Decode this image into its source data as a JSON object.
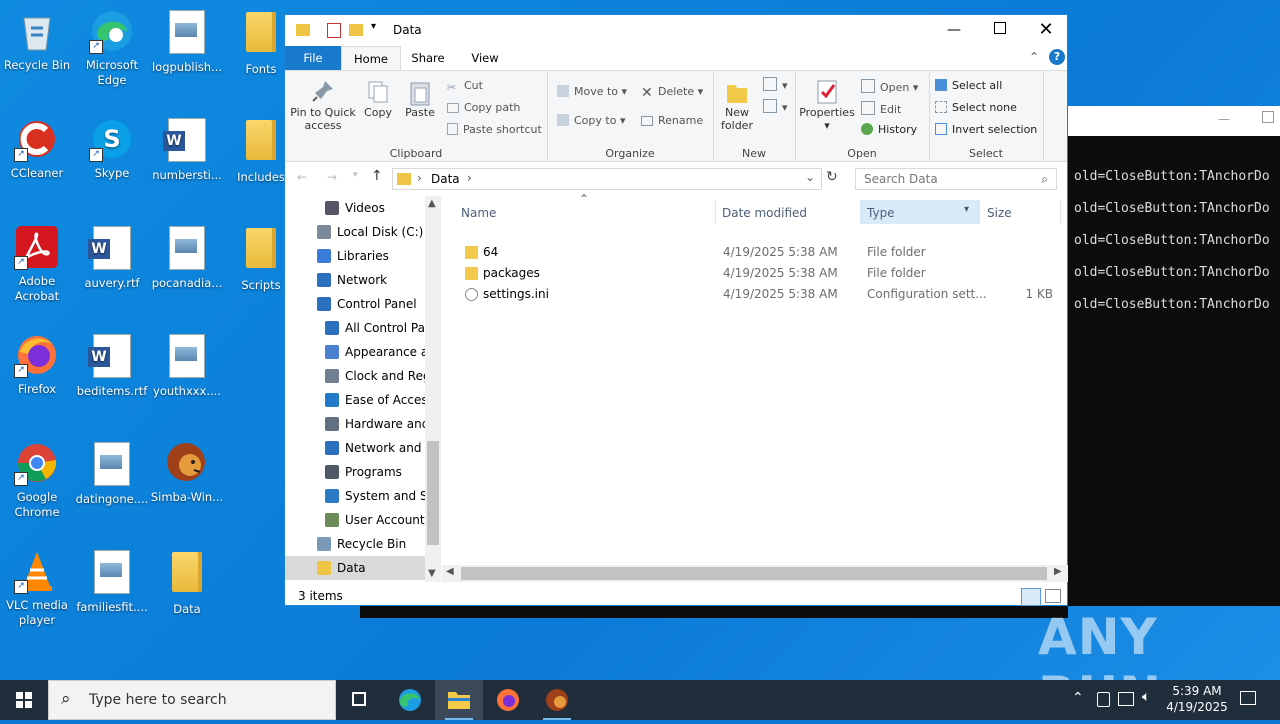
{
  "desktop": {
    "icons": [
      {
        "label": "Recycle Bin"
      },
      {
        "label": "Microsoft Edge"
      },
      {
        "label": "logpublish..."
      },
      {
        "label": "Fonts"
      },
      {
        "label": "CCleaner"
      },
      {
        "label": "Skype"
      },
      {
        "label": "numbersti..."
      },
      {
        "label": "Includes"
      },
      {
        "label": "Adobe Acrobat"
      },
      {
        "label": "auvery.rtf"
      },
      {
        "label": "pocanadia..."
      },
      {
        "label": "Scripts"
      },
      {
        "label": "Firefox"
      },
      {
        "label": "beditems.rtf"
      },
      {
        "label": "youthxxx...."
      },
      {
        "label": "Google Chrome"
      },
      {
        "label": "datingone...."
      },
      {
        "label": "Simba-Win..."
      },
      {
        "label": "VLC media player"
      },
      {
        "label": "familiesfit...."
      },
      {
        "label": "Data"
      }
    ]
  },
  "terminal": {
    "lines": [
      "old=CloseButton:TAnchorDo",
      "old=CloseButton:TAnchorDo",
      "old=CloseButton:TAnchorDo",
      "old=CloseButton:TAnchorDo",
      "old=CloseButton:TAnchorDo"
    ]
  },
  "explorer": {
    "title": "Data",
    "tabs": {
      "file": "File",
      "home": "Home",
      "share": "Share",
      "view": "View"
    },
    "ribbon": {
      "clipboard": {
        "label": "Clipboard",
        "pin": "Pin to Quick access",
        "copy": "Copy",
        "paste": "Paste",
        "cut": "Cut",
        "copy_path": "Copy path",
        "paste_shortcut": "Paste shortcut"
      },
      "organize": {
        "label": "Organize",
        "move_to": "Move to",
        "copy_to": "Copy to",
        "delete": "Delete",
        "rename": "Rename"
      },
      "new": {
        "label": "New",
        "new_folder": "New folder"
      },
      "open": {
        "label": "Open",
        "properties": "Properties",
        "open": "Open",
        "edit": "Edit",
        "history": "History"
      },
      "select": {
        "label": "Select",
        "select_all": "Select all",
        "select_none": "Select none",
        "invert": "Invert selection"
      }
    },
    "address": {
      "path": "Data",
      "search_placeholder": "Search Data"
    },
    "nav_items": [
      {
        "label": "Videos",
        "icon": "videos-icon"
      },
      {
        "label": "Local Disk (C:)",
        "icon": "drive-icon"
      },
      {
        "label": "Libraries",
        "icon": "libraries-icon"
      },
      {
        "label": "Network",
        "icon": "network-icon"
      },
      {
        "label": "Control Panel",
        "icon": "control-panel-icon"
      },
      {
        "label": "All Control Par",
        "icon": "control-panel-icon"
      },
      {
        "label": "Appearance an",
        "icon": "appearance-icon"
      },
      {
        "label": "Clock and Regi",
        "icon": "clock-icon"
      },
      {
        "label": "Ease of Access",
        "icon": "ease-access-icon"
      },
      {
        "label": "Hardware and",
        "icon": "hardware-icon"
      },
      {
        "label": "Network and Ir",
        "icon": "network-icon"
      },
      {
        "label": "Programs",
        "icon": "programs-icon"
      },
      {
        "label": "System and Sec",
        "icon": "security-icon"
      },
      {
        "label": "User Accounts",
        "icon": "users-icon"
      },
      {
        "label": "Recycle Bin",
        "icon": "recycle-bin-icon"
      },
      {
        "label": "Data",
        "icon": "folder-icon"
      }
    ],
    "columns": {
      "name": "Name",
      "date": "Date modified",
      "type": "Type",
      "size": "Size"
    },
    "files": [
      {
        "name": "64",
        "date": "4/19/2025 5:38 AM",
        "type": "File folder",
        "size": ""
      },
      {
        "name": "packages",
        "date": "4/19/2025 5:38 AM",
        "type": "File folder",
        "size": ""
      },
      {
        "name": "settings.ini",
        "date": "4/19/2025 5:38 AM",
        "type": "Configuration sett...",
        "size": "1 KB"
      }
    ],
    "status": "3 items"
  },
  "taskbar": {
    "search_placeholder": "Type here to search",
    "time": "5:39 AM",
    "date": "4/19/2025"
  },
  "watermark": "ANY RUN",
  "colors": {
    "desktop": "#0a78d7",
    "accent": "#1979ca",
    "taskbar": "#202d3a",
    "selection": "#cce8ff"
  }
}
